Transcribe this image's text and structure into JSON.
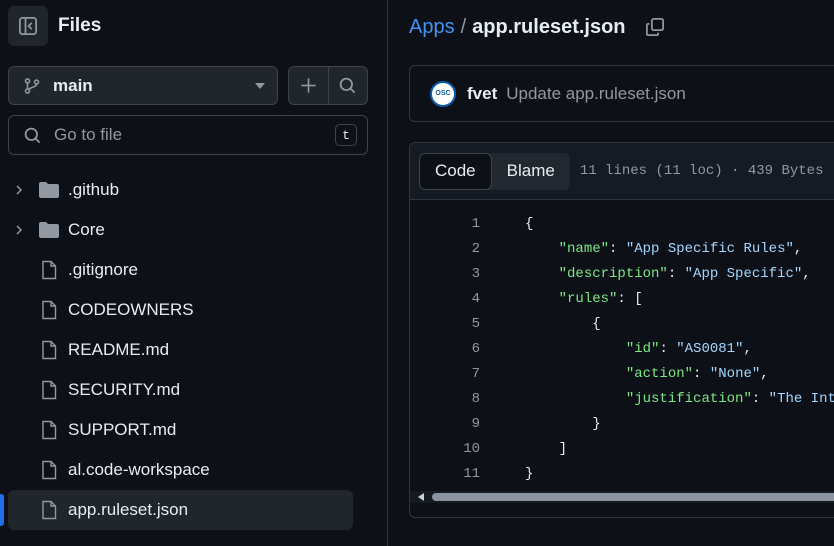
{
  "sidebar": {
    "title": "Files",
    "branch": "main",
    "search_placeholder": "Go to file",
    "search_shortcut": "t",
    "items": [
      {
        "name": ".github",
        "type": "folder"
      },
      {
        "name": "Core",
        "type": "folder"
      },
      {
        "name": ".gitignore",
        "type": "file"
      },
      {
        "name": "CODEOWNERS",
        "type": "file"
      },
      {
        "name": "README.md",
        "type": "file"
      },
      {
        "name": "SECURITY.md",
        "type": "file"
      },
      {
        "name": "SUPPORT.md",
        "type": "file"
      },
      {
        "name": "al.code-workspace",
        "type": "file"
      },
      {
        "name": "app.ruleset.json",
        "type": "file",
        "active": true
      }
    ]
  },
  "breadcrumb": {
    "parent": "Apps",
    "separator": "/",
    "current": "app.ruleset.json"
  },
  "commit": {
    "avatar_text": "OSC",
    "author": "fvet",
    "message": "Update app.ruleset.json"
  },
  "file": {
    "tabs": [
      "Code",
      "Blame"
    ],
    "active_tab": "Code",
    "meta": "11 lines (11 loc) · 439 Bytes",
    "lines": [
      {
        "n": "1",
        "text": "{"
      },
      {
        "n": "2",
        "text": "    \"name\": \"App Specific Rules\","
      },
      {
        "n": "3",
        "text": "    \"description\": \"App Specific\","
      },
      {
        "n": "4",
        "text": "    \"rules\": ["
      },
      {
        "n": "5",
        "text": "        {"
      },
      {
        "n": "6",
        "text": "            \"id\": \"AS0081\","
      },
      {
        "n": "7",
        "text": "            \"action\": \"None\","
      },
      {
        "n": "8",
        "text": "            \"justification\": \"The Inte"
      },
      {
        "n": "9",
        "text": "        }"
      },
      {
        "n": "10",
        "text": "    ]"
      },
      {
        "n": "11",
        "text": "}"
      }
    ]
  },
  "colors": {
    "background": "#0d1117",
    "accent": "#4493f8",
    "json_key": "#7ee787",
    "json_string": "#a5d6ff",
    "active_indicator": "#1f6feb"
  }
}
